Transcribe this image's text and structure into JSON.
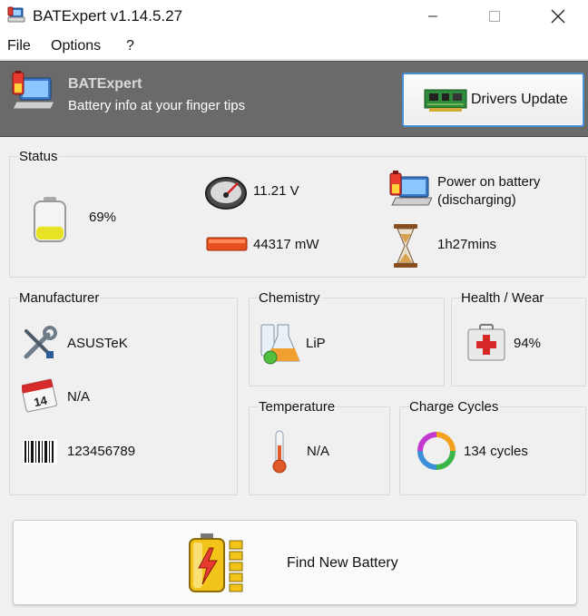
{
  "window": {
    "title": "BATExpert v1.14.5.27"
  },
  "menu": {
    "items": [
      "File",
      "Options",
      "?"
    ]
  },
  "header": {
    "title": "BATExpert",
    "subtitle": "Battery info at your finger tips",
    "drivers_button": "Drivers Update"
  },
  "status": {
    "title": "Status",
    "charge": "69%",
    "charge_fraction": 0.69,
    "voltage": "11.21 V",
    "power": "44317 mW",
    "power_state_line1": "Power on battery",
    "power_state_line2": "(discharging)",
    "time_left": "1h27mins"
  },
  "manufacturer": {
    "title": "Manufacturer",
    "name": "ASUSTeK",
    "date": "N/A",
    "serial": "123456789"
  },
  "chemistry": {
    "title": "Chemistry",
    "value": "LiP"
  },
  "health": {
    "title": "Health / Wear",
    "value": "94%"
  },
  "temperature": {
    "title": "Temperature",
    "value": "N/A"
  },
  "cycles": {
    "title": "Charge Cycles",
    "value": "134 cycles"
  },
  "find_button": {
    "label": "Find New Battery"
  },
  "icons": {
    "app": "battery-laptop-icon",
    "minimize": "minimize-icon",
    "maximize": "maximize-icon",
    "close": "close-icon"
  },
  "colors": {
    "header_bg": "#6a6a6a",
    "accent_border": "#4a90d9",
    "window_bg": "#f0f0f0"
  }
}
